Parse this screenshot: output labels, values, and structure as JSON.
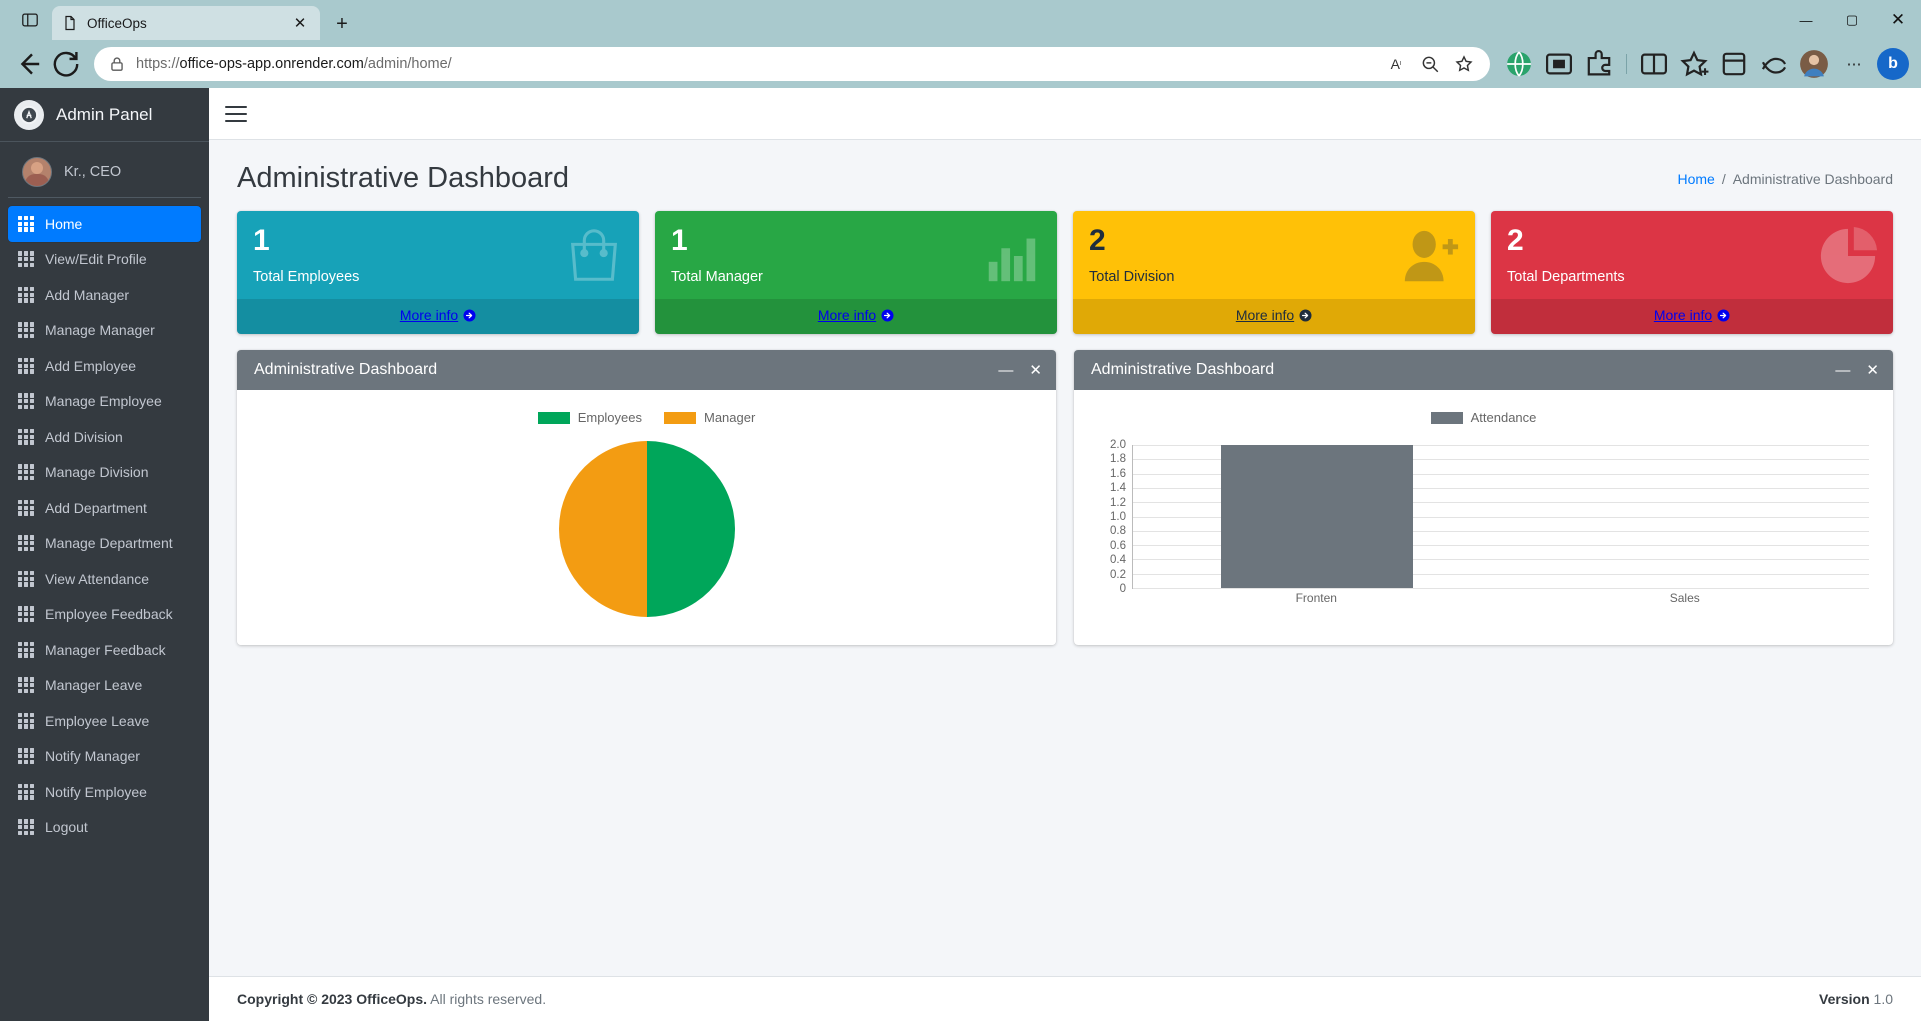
{
  "browser": {
    "tab": {
      "title": "OfficeOps",
      "favicon_icon": "page-icon",
      "close_icon": "✕"
    },
    "newtab_label": "+",
    "collections_icon": "browser-essentials-icon",
    "back_icon": "←",
    "reload_icon": "⟳",
    "lock_icon": "lock-icon",
    "url_scheme": "https://",
    "url_host": "office-ops-app.onrender.com",
    "url_path": "/admin/home/",
    "url_full": "https://office-ops-app.onrender.com/admin/home/",
    "addressbar_icons": [
      "read-aloud-icon",
      "zoom-out-icon",
      "favorite-star-icon"
    ],
    "toolbar_icons": [
      "browser-globe-icon",
      "split-screen-icon",
      "extensions-icon",
      "vertical-tabs-icon",
      "favorites-icon",
      "collections-icon",
      "browser-profile-icon",
      "settings-more-icon"
    ],
    "copilot_label": "b",
    "window_controls": {
      "minimize": "—",
      "maximize": "▢",
      "close": "✕"
    }
  },
  "sidebar": {
    "brand": {
      "label": "Admin Panel",
      "logo_icon": "admin-logo-icon"
    },
    "user": {
      "name": "Kr., CEO",
      "avatar_icon": "user-avatar"
    },
    "items": [
      {
        "label": "Home",
        "active": true
      },
      {
        "label": "View/Edit Profile",
        "active": false
      },
      {
        "label": "Add Manager",
        "active": false
      },
      {
        "label": "Manage Manager",
        "active": false
      },
      {
        "label": "Add Employee",
        "active": false
      },
      {
        "label": "Manage Employee",
        "active": false
      },
      {
        "label": "Add Division",
        "active": false
      },
      {
        "label": "Manage Division",
        "active": false
      },
      {
        "label": "Add Department",
        "active": false
      },
      {
        "label": "Manage Department",
        "active": false
      },
      {
        "label": "View Attendance",
        "active": false
      },
      {
        "label": "Employee Feedback",
        "active": false
      },
      {
        "label": "Manager Feedback",
        "active": false
      },
      {
        "label": "Manager Leave",
        "active": false
      },
      {
        "label": "Employee Leave",
        "active": false
      },
      {
        "label": "Notify Manager",
        "active": false
      },
      {
        "label": "Notify Employee",
        "active": false
      },
      {
        "label": "Logout",
        "active": false
      }
    ]
  },
  "topnav": {
    "menu_toggle_icon": "hamburger-icon"
  },
  "page": {
    "title": "Administrative Dashboard",
    "breadcrumb": {
      "home": "Home",
      "separator": "/",
      "current": "Administrative Dashboard"
    }
  },
  "cards": [
    {
      "value": "1",
      "label": "Total Employees",
      "more": "More info",
      "color": "#17a2b8",
      "icon": "shopping-bag-icon",
      "theme": "teal"
    },
    {
      "value": "1",
      "label": "Total Manager",
      "more": "More info",
      "color": "#28a745",
      "icon": "bar-chart-icon",
      "theme": "green"
    },
    {
      "value": "2",
      "label": "Total Division",
      "more": "More info",
      "color": "#ffc107",
      "icon": "user-plus-icon",
      "theme": "yellow"
    },
    {
      "value": "2",
      "label": "Total Departments",
      "more": "More info",
      "color": "#dc3545",
      "icon": "pie-chart-icon",
      "theme": "red"
    }
  ],
  "panels": [
    {
      "title": "Administrative Dashboard",
      "minimize_icon": "—",
      "close_icon": "✕"
    },
    {
      "title": "Administrative Dashboard",
      "minimize_icon": "—",
      "close_icon": "✕"
    }
  ],
  "chart_data": [
    {
      "type": "pie",
      "title": "Administrative Dashboard",
      "labels": [
        "Employees",
        "Manager"
      ],
      "values": [
        1,
        1
      ],
      "colors": [
        "#00a65a",
        "#f39c12"
      ],
      "legend_position": "top"
    },
    {
      "type": "bar",
      "title": "Administrative Dashboard",
      "categories": [
        "Fronten",
        "Sales"
      ],
      "series": [
        {
          "name": "Attendance",
          "values": [
            2,
            0
          ]
        }
      ],
      "colors": [
        "#6c757d"
      ],
      "ylim": [
        0,
        2.0
      ],
      "yticks": [
        "2.0",
        "1.8",
        "1.6",
        "1.4",
        "1.2",
        "1.0",
        "0.8",
        "0.6",
        "0.4",
        "0.2",
        "0"
      ],
      "xlabel": "",
      "ylabel": "",
      "grid": true,
      "legend_position": "top"
    }
  ],
  "footer": {
    "copyright_strong": "Copyright © 2023 OfficeOps.",
    "copyright_rest": " All rights reserved.",
    "version_label": "Version",
    "version_value": "1.0"
  }
}
